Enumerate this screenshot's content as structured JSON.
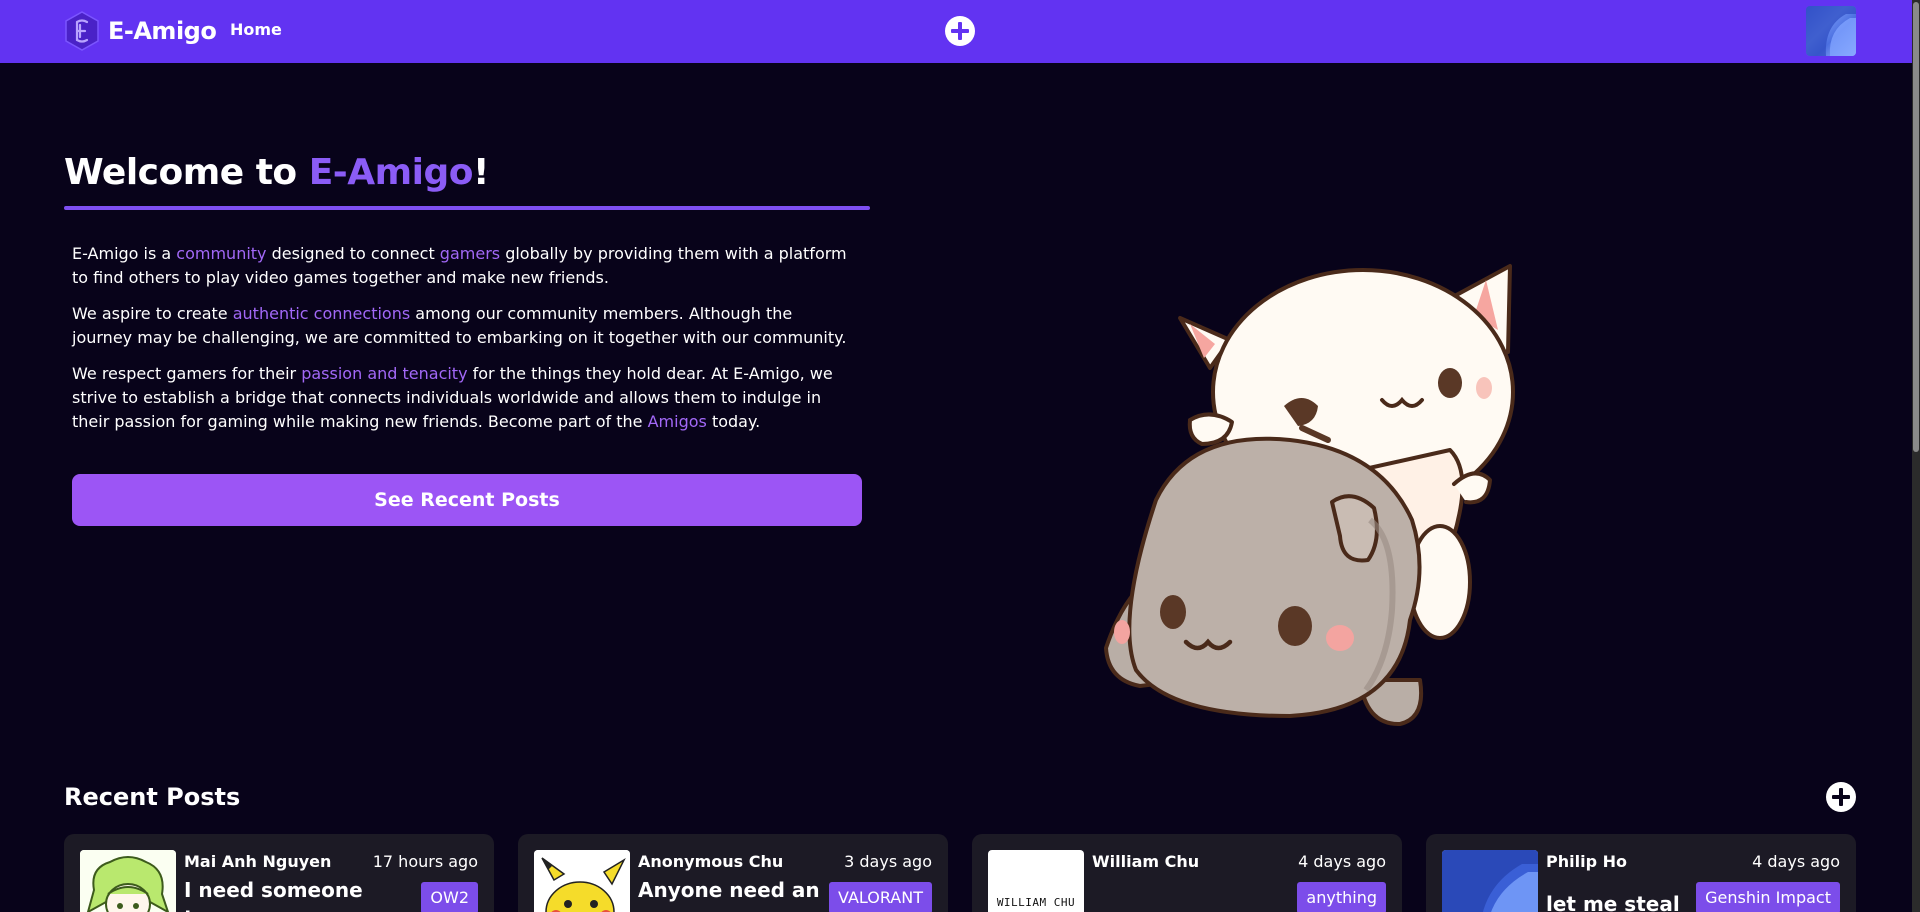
{
  "navbar": {
    "brand_name": "E-Amigo",
    "home_label": "Home",
    "accent_color": "#6233f2"
  },
  "hero": {
    "title_prefix": "Welcome to ",
    "title_accent": "E-Amigo",
    "title_suffix": "!",
    "paragraphs": [
      {
        "parts": [
          "E-Amigo is a ",
          "community",
          " designed to connect ",
          "gamers",
          " globally by providing them with a platform to find others to play video games together and make new friends."
        ]
      },
      {
        "parts": [
          "We aspire to create ",
          "authentic connections",
          " among our community members. Although the journey may be challenging, we are committed to embarking on it together with our community."
        ]
      },
      {
        "parts": [
          "We respect gamers for their ",
          "passion and tenacity",
          " for the things they hold dear. At E-Amigo, we strive to establish a bridge that connects individuals worldwide and allows them to indulge in their passion for gaming while making new friends. Become part of the ",
          "Amigos",
          " today."
        ]
      }
    ],
    "cta_label": "See Recent Posts",
    "highlight_color": "#a268f7"
  },
  "recent": {
    "title": "Recent Posts",
    "posts": [
      {
        "author": "Mai Anh Nguyen",
        "time": "17 hours ago",
        "tag": "OW2",
        "title": "I need someone to",
        "thumb": "anime-avatar"
      },
      {
        "author": "Anonymous Chu",
        "time": "3 days ago",
        "tag": "VALORANT",
        "title": "Anyone need an e",
        "thumb": "pikachu"
      },
      {
        "author": "William Chu",
        "time": "4 days ago",
        "tag": "anything",
        "title": "",
        "thumb_text": "WILLIAM CHU"
      },
      {
        "author": "Philip Ho",
        "time": "4 days ago",
        "tag": "Genshin Impact",
        "title": "let me steal",
        "thumb": "blue-wallpaper"
      }
    ]
  }
}
